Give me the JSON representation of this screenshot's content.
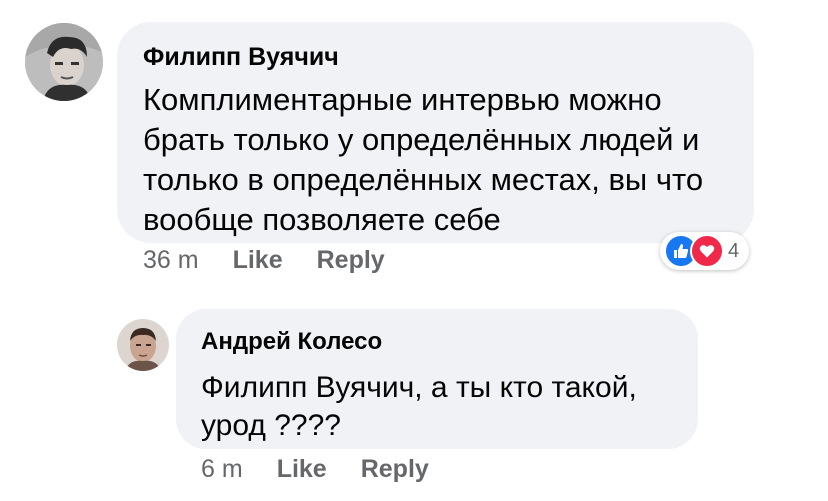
{
  "comments": [
    {
      "author": "Филипп Вуячич",
      "text": "Комплиментарные интервью можно\nбрать только у определённых людей и\nтолько в определённых местах, вы что\nвообще позволяете себе",
      "time": "36 m",
      "like_label": "Like",
      "reply_label": "Reply",
      "reactions": {
        "icons": [
          "like-icon",
          "love-icon"
        ],
        "count": "4",
        "colors": {
          "like": "#1877f2",
          "love": "#f02849"
        }
      }
    }
  ],
  "replies": [
    {
      "author": "Андрей Колесо",
      "text": "Филипп Вуячич, а ты кто такой,\nурод ????",
      "time": "6 m",
      "like_label": "Like",
      "reply_label": "Reply"
    }
  ],
  "colors": {
    "bubble_bg": "#f0f2f5",
    "primary_text": "#050505",
    "secondary_text": "#65676b"
  }
}
